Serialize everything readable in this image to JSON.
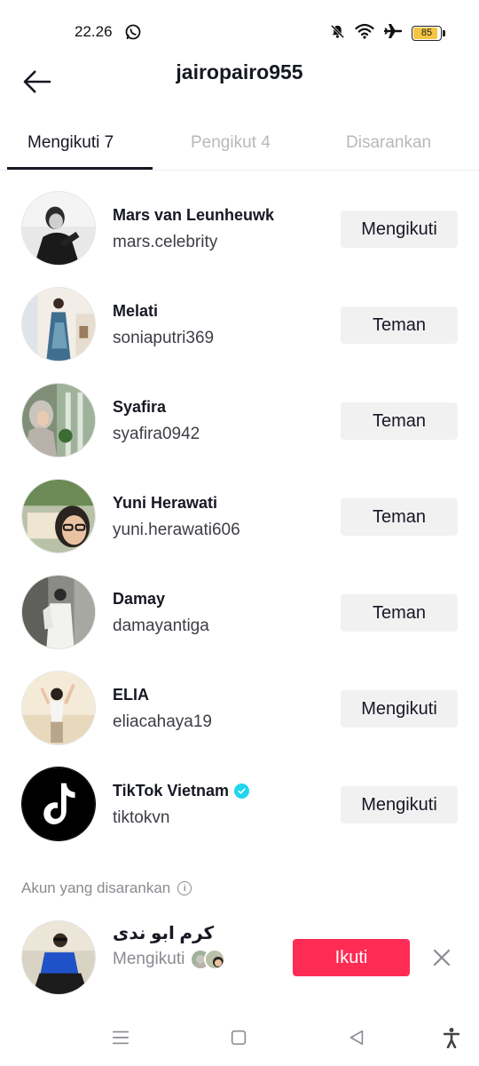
{
  "status_bar": {
    "time": "22.26",
    "battery": "85",
    "battery_level": 0.85,
    "icons": [
      "whatsapp-icon",
      "mute-bell-icon",
      "wifi-icon",
      "airplane-icon",
      "battery-icon"
    ]
  },
  "header": {
    "title": "jairopairo955",
    "back_icon": "arrow-left-icon"
  },
  "tabs": [
    {
      "label": "Mengikuti 7",
      "active": true
    },
    {
      "label": "Pengikut 4",
      "active": false
    },
    {
      "label": "Disarankan",
      "active": false
    }
  ],
  "following": [
    {
      "name": "Mars van Leunheuwk",
      "handle": "mars.celebrity",
      "button": "Mengikuti",
      "verified": false
    },
    {
      "name": "Melati",
      "handle": "soniaputri369",
      "button": "Teman",
      "verified": false
    },
    {
      "name": "Syafira",
      "handle": "syafira0942",
      "button": "Teman",
      "verified": false
    },
    {
      "name": "Yuni Herawati",
      "handle": "yuni.herawati606",
      "button": "Teman",
      "verified": false
    },
    {
      "name": "Damay",
      "handle": "damayantiga",
      "button": "Teman",
      "verified": false
    },
    {
      "name": "ELIA",
      "handle": "eliacahaya19",
      "button": "Mengikuti",
      "verified": false
    },
    {
      "name": "TikTok Vietnam",
      "handle": "tiktokvn",
      "button": "Mengikuti",
      "verified": true
    }
  ],
  "suggested": {
    "title": "Akun yang disarankan",
    "account": {
      "name": "كرم ابو ندى",
      "subtitle": "Mengikuti",
      "follow_button": "Ikuti"
    }
  },
  "colors": {
    "accent": "#fe2c55",
    "verified": "#20d5ec",
    "button_bg": "#f1f1f2"
  }
}
